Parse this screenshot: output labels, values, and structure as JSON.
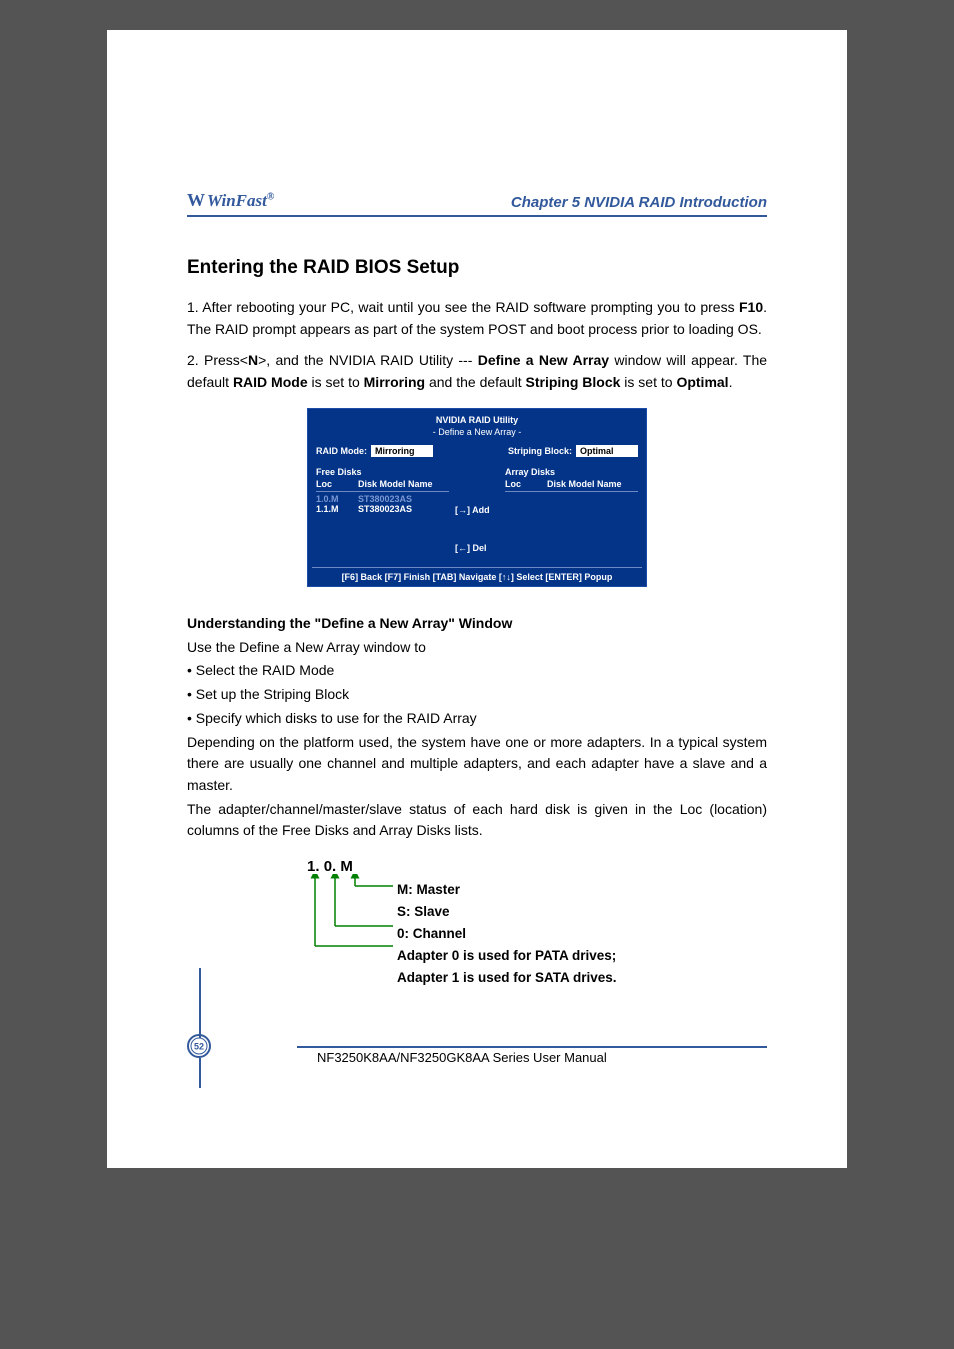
{
  "header": {
    "brand_w": "W",
    "brand_name": "WinFast",
    "brand_reg": "®",
    "chapter": "Chapter 5  NVIDIA RAID Introduction"
  },
  "section_title": "Entering the RAID BIOS Setup",
  "p1_a": "1. After rebooting your PC, wait until you see the RAID software prompting you to press ",
  "p1_b_bold": "F10",
  "p1_c": ". The RAID prompt appears as part of the system POST and boot process prior to loading OS.",
  "p2_a": "2. Press<",
  "p2_b_bold": "N",
  "p2_c": ">, and the NVIDIA RAID Utility --- ",
  "p2_d_bold": "Define a New Array",
  "p2_e": " window will appear. The default ",
  "p2_f_bold": "RAID Mode",
  "p2_g": " is set to ",
  "p2_h_bold": "Mirroring",
  "p2_i": " and the default ",
  "p2_j_bold": "Striping Block",
  "p2_k": " is set to ",
  "p2_l_bold": "Optimal",
  "p2_m": ".",
  "bios": {
    "title": "NVIDIA RAID Utility",
    "subtitle": "-   Define a New Array   -",
    "raid_mode_label": "RAID Mode:",
    "raid_mode_value": "Mirroring",
    "striping_label": "Striping Block:",
    "striping_value": "Optimal",
    "free_disks_label": "Free Disks",
    "array_disks_label": "Array Disks",
    "loc_label": "Loc",
    "model_label": "Disk Model Name",
    "disks": [
      {
        "loc": "1.0.M",
        "model": "ST380023AS",
        "dim": true
      },
      {
        "loc": "1.1.M",
        "model": "ST380023AS",
        "dim": false
      }
    ],
    "add_label": "[→] Add",
    "del_label": "[←] Del",
    "footer": "[F6] Back   [F7] Finish   [TAB] Navigate   [↑↓] Select   [ENTER] Popup"
  },
  "subhead": "Understanding the \"Define a New Array\" Window",
  "u1": "Use the Define a New Array window to",
  "u2": "• Select the RAID Mode",
  "u3": "• Set up the Striping Block",
  "u4": "• Specify which disks to use for the RAID Array",
  "u5": "Depending on the platform used, the system have one or more adapters. In a typical system there are usually one channel and multiple adapters, and each adapter have a slave and a master.",
  "u6": "The adapter/channel/master/slave status of each hard disk is given in the Loc (location) columns of the Free Disks and Array Disks lists.",
  "diagram": {
    "code_1": "1.",
    "code_2": "0.",
    "code_3": "M",
    "l1": "M: Master",
    "l2": "S: Slave",
    "l3": "0: Channel",
    "l4": "Adapter 0 is used for PATA drives;",
    "l5": "Adapter 1 is used for SATA drives."
  },
  "footer": {
    "page_number": "52",
    "manual": "NF3250K8AA/NF3250GK8AA Series User Manual"
  }
}
